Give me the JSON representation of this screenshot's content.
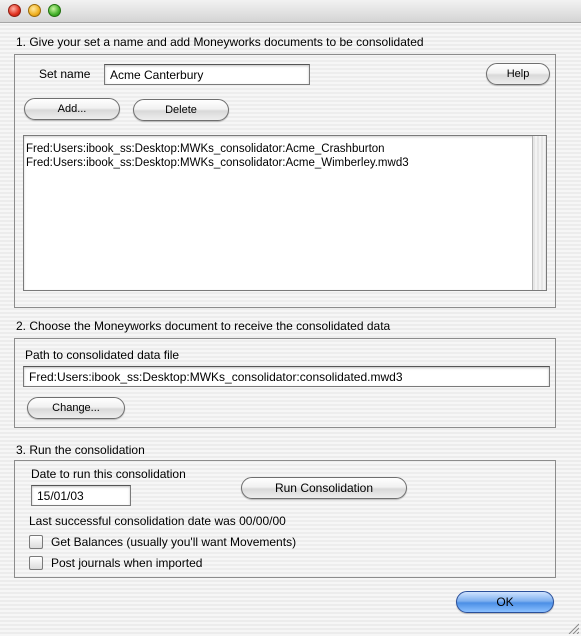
{
  "window": {
    "controls": [
      "close",
      "minimize",
      "zoom"
    ]
  },
  "section1": {
    "title": "1. Give your set a name and add Moneyworks documents to be consolidated",
    "set_name_label": "Set name",
    "set_name_value": "Acme Canterbury",
    "help_label": "Help",
    "add_label": "Add...",
    "delete_label": "Delete",
    "documents": [
      "Fred:Users:ibook_ss:Desktop:MWKs_consolidator:Acme_Crashburton",
      "Fred:Users:ibook_ss:Desktop:MWKs_consolidator:Acme_Wimberley.mwd3"
    ]
  },
  "section2": {
    "title": "2. Choose the Moneyworks document to receive the consolidated data",
    "path_label": "Path to consolidated data file",
    "path_value": "Fred:Users:ibook_ss:Desktop:MWKs_consolidator:consolidated.mwd3",
    "change_label": "Change..."
  },
  "section3": {
    "title": "3. Run the consolidation",
    "date_label": "Date to run this consolidation",
    "date_value": "15/01/03",
    "run_label": "Run Consolidation",
    "last_success": "Last successful consolidation date was 00/00/00",
    "get_balances_label": "Get Balances (usually you'll want Movements)",
    "post_journals_label": "Post journals when imported"
  },
  "footer": {
    "ok_label": "OK"
  }
}
